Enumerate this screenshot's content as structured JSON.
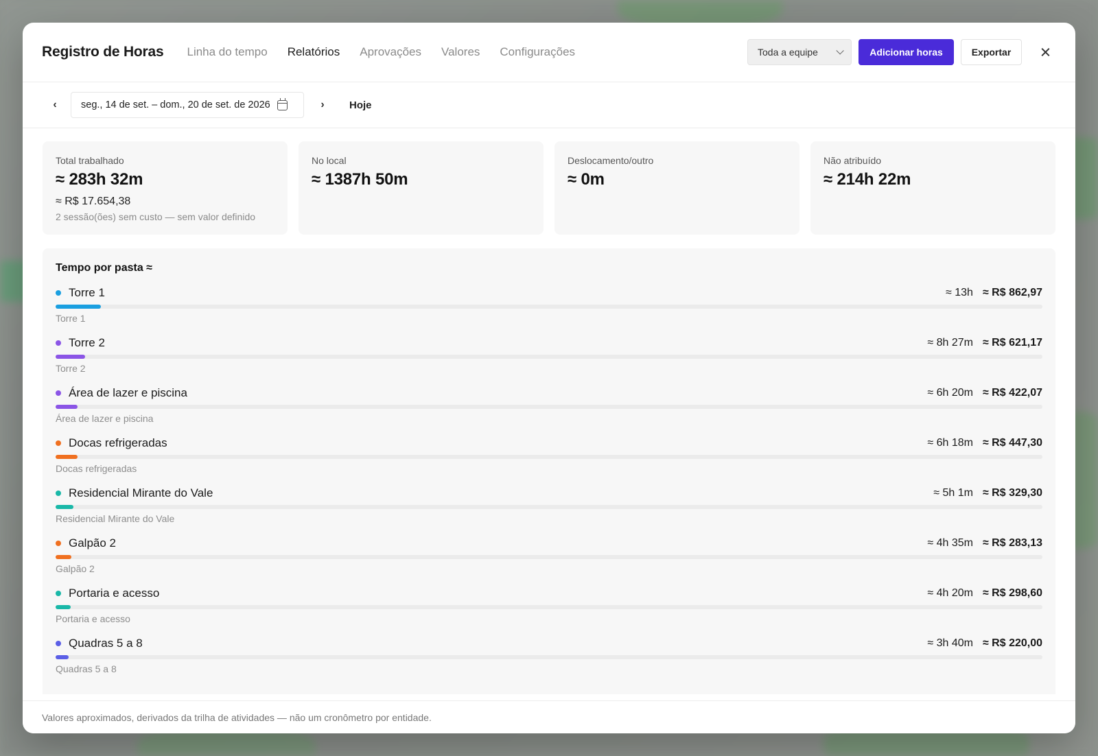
{
  "header": {
    "title": "Registro de Horas",
    "tabs": [
      {
        "label": "Linha do tempo",
        "active": false
      },
      {
        "label": "Relatórios",
        "active": true
      },
      {
        "label": "Aprovações",
        "active": false
      },
      {
        "label": "Valores",
        "active": false
      },
      {
        "label": "Configurações",
        "active": false
      }
    ],
    "team_select": "Toda a equipe",
    "add_hours_label": "Adicionar horas",
    "export_label": "Exportar"
  },
  "datebar": {
    "range": "seg., 14 de set. – dom., 20 de set. de 2026",
    "today_label": "Hoje"
  },
  "stats": [
    {
      "label": "Total trabalhado",
      "value": "≈ 283h 32m",
      "money": "≈ R$ 17.654,38",
      "note": "2 sessão(ões) sem custo — sem valor definido"
    },
    {
      "label": "No local",
      "value": "≈ 1387h 50m"
    },
    {
      "label": "Deslocamento/outro",
      "value": "≈ 0m"
    },
    {
      "label": "Não atribuído",
      "value": "≈ 214h 22m"
    }
  ],
  "folders": {
    "title": "Tempo por pasta ≈",
    "items": [
      {
        "name": "Torre 1",
        "sub": "Torre 1",
        "time": "≈ 13h",
        "money": "≈ R$ 862,97",
        "color": "#1a9fe0",
        "share": 0.046
      },
      {
        "name": "Torre 2",
        "sub": "Torre 2",
        "time": "≈ 8h 27m",
        "money": "≈ R$ 621,17",
        "color": "#8b55e6",
        "share": 0.03
      },
      {
        "name": "Área de lazer e piscina",
        "sub": "Área de lazer e piscina",
        "time": "≈ 6h 20m",
        "money": "≈ R$ 422,07",
        "color": "#8b55e6",
        "share": 0.022
      },
      {
        "name": "Docas refrigeradas",
        "sub": "Docas refrigeradas",
        "time": "≈ 6h 18m",
        "money": "≈ R$ 447,30",
        "color": "#f07020",
        "share": 0.022
      },
      {
        "name": "Residencial Mirante do Vale",
        "sub": "Residencial Mirante do Vale",
        "time": "≈ 5h 1m",
        "money": "≈ R$ 329,30",
        "color": "#1ab8a8",
        "share": 0.018
      },
      {
        "name": "Galpão 2",
        "sub": "Galpão 2",
        "time": "≈ 4h 35m",
        "money": "≈ R$ 283,13",
        "color": "#f07020",
        "share": 0.016
      },
      {
        "name": "Portaria e acesso",
        "sub": "Portaria e acesso",
        "time": "≈ 4h 20m",
        "money": "≈ R$ 298,60",
        "color": "#1ab8a8",
        "share": 0.015
      },
      {
        "name": "Quadras 5 a 8",
        "sub": "Quadras 5 a 8",
        "time": "≈ 3h 40m",
        "money": "≈ R$ 220,00",
        "color": "#5b5fe6",
        "share": 0.013
      }
    ]
  },
  "footer": {
    "note": "Valores aproximados, derivados da trilha de atividades — não um cronômetro por entidade."
  }
}
